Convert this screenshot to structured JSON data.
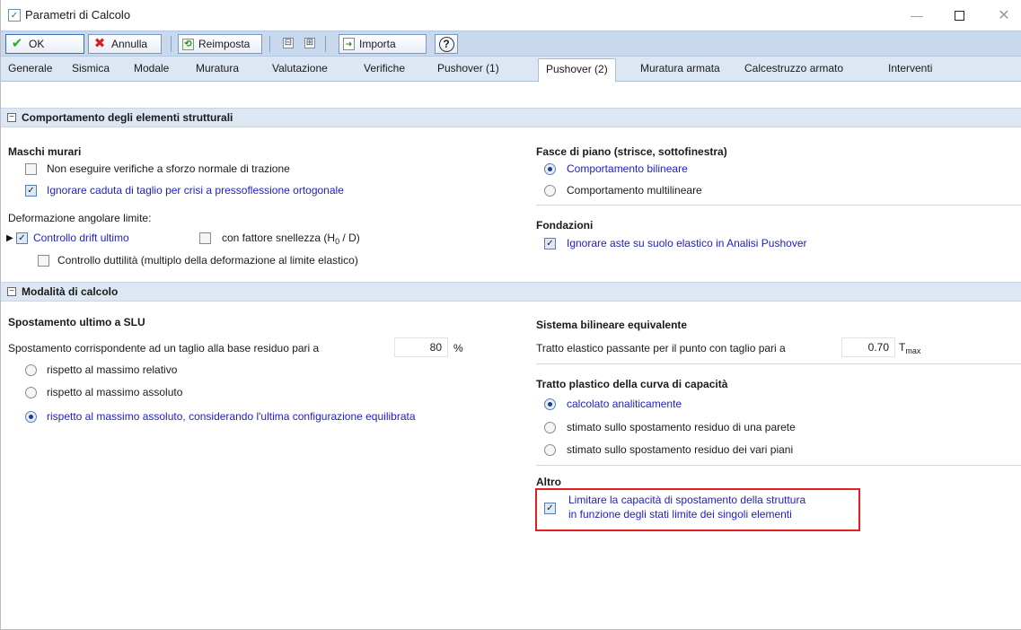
{
  "window": {
    "title": "Parametri di Calcolo"
  },
  "toolbar": {
    "ok_label": "OK",
    "annulla_label": "Annulla",
    "reimposta_label": "Reimposta",
    "collapse_all_glyph": "⊟",
    "expand_all_glyph": "⊞",
    "importa_label": "Importa",
    "help_glyph": "?"
  },
  "tabs": [
    {
      "label": "Generale"
    },
    {
      "label": "Sismica"
    },
    {
      "label": "Modale"
    },
    {
      "label": "Muratura"
    },
    {
      "label": "Valutazione"
    },
    {
      "label": "Verifiche"
    },
    {
      "label": "Pushover (1)"
    },
    {
      "label": "Pushover (2)",
      "active": true
    },
    {
      "label": "Muratura armata"
    },
    {
      "label": "Calcestruzzo armato"
    },
    {
      "label": "Interventi"
    }
  ],
  "section1": {
    "title": "Comportamento degli elementi strutturali",
    "maschi": {
      "title": "Maschi murari",
      "opt1": "Non eseguire verifiche a sforzo normale di trazione",
      "opt2": "Ignorare caduta di taglio per crisi a pressoflessione ortogonale",
      "def_label": "Deformazione angolare limite:",
      "drift": "Controllo drift ultimo",
      "snellezza_pre": "con fattore snellezza (H",
      "snellezza_sub": "0",
      "snellezza_post": " / D)",
      "duttilita": "Controllo duttilità (multiplo della deformazione al limite elastico)"
    },
    "fasce": {
      "title": "Fasce di piano (strisce, sottofinestra)",
      "opt1": "Comportamento bilineare",
      "opt2": "Comportamento multilineare"
    },
    "fondazioni": {
      "title": "Fondazioni",
      "opt1": "Ignorare aste su suolo elastico in Analisi Pushover"
    }
  },
  "section2": {
    "title": "Modalità di calcolo",
    "spostamento": {
      "title": "Spostamento ultimo a SLU",
      "label": "Spostamento corrispondente ad un taglio alla base residuo pari a",
      "value": "80",
      "unit": "%",
      "opt1": "rispetto al massimo relativo",
      "opt2": "rispetto al massimo assoluto",
      "opt3": "rispetto al massimo assoluto, considerando l'ultima configurazione equilibrata"
    },
    "bilineare": {
      "title": "Sistema bilineare equivalente",
      "label": "Tratto elastico passante per il punto con taglio pari a",
      "value": "0.70",
      "unit_main": "T",
      "unit_sub": "max"
    },
    "plastico": {
      "title": "Tratto plastico della curva di capacità",
      "opt1": "calcolato analiticamente",
      "opt2": "stimato sullo spostamento residuo di una parete",
      "opt3": "stimato sullo spostamento residuo dei vari piani"
    },
    "altro": {
      "title": "Altro",
      "line1": "Limitare la capacità di spostamento della struttura",
      "line2": "in funzione degli stati limite dei singoli elementi"
    }
  },
  "colors": {
    "toolbar_bg": "#c8d9ee",
    "section_bg": "#dde7f3",
    "link_blue": "#2020c8",
    "highlight_red": "#e02020"
  }
}
